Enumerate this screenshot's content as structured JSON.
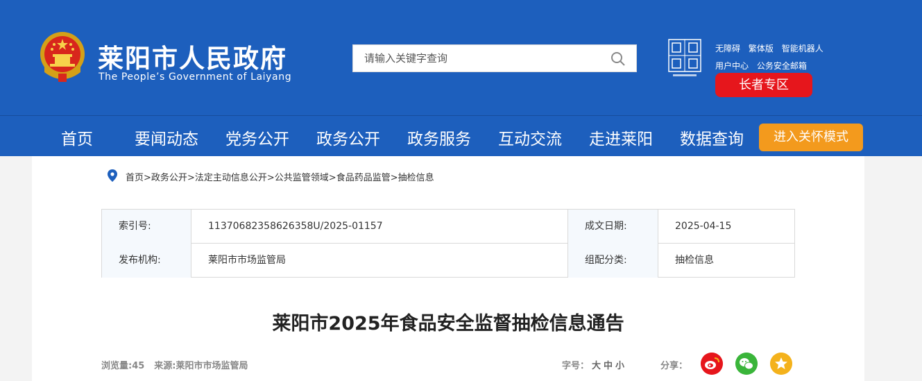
{
  "header": {
    "site_title": "莱阳市人民政府",
    "site_subtitle": "The People’s Government of Laiyang",
    "search_placeholder": "请输入关键字查询",
    "util_links_row1": [
      "无障碍",
      "繁体版",
      "智能机器人"
    ],
    "util_links_row2": [
      "用户中心",
      "公务安全邮箱"
    ],
    "elder_zone_label": "长者专区",
    "colors": {
      "header_bg": "#1d5fbd",
      "elder_btn": "#e6161c",
      "care_btn": "#f39a1d"
    }
  },
  "nav": {
    "items": [
      "首页",
      "要闻动态",
      "党务公开",
      "政务公开",
      "政务服务",
      "互动交流",
      "走进莱阳",
      "数据查询"
    ],
    "care_mode_label": "进入关怀模式"
  },
  "breadcrumb": {
    "items": [
      "首页",
      "政务公开",
      "法定主动信息公开",
      "公共监管领域",
      "食品药品监管",
      "抽检信息"
    ],
    "separator": ">"
  },
  "meta": {
    "index_label": "索引号:",
    "index_value": "11370682358626358U/2025-01157",
    "date_label": "成文日期:",
    "date_value": "2025-04-15",
    "publisher_label": "发布机构:",
    "publisher_value": "莱阳市市场监管局",
    "category_label": "组配分类:",
    "category_value": "抽检信息"
  },
  "article": {
    "title": "莱阳市2025年食品安全监督抽检信息通告",
    "views": "浏览量:45",
    "source": "来源:莱阳市市场监管局",
    "font_size_label": "字号：",
    "font_sizes": [
      "大",
      "中",
      "小"
    ],
    "share_label": "分享："
  }
}
